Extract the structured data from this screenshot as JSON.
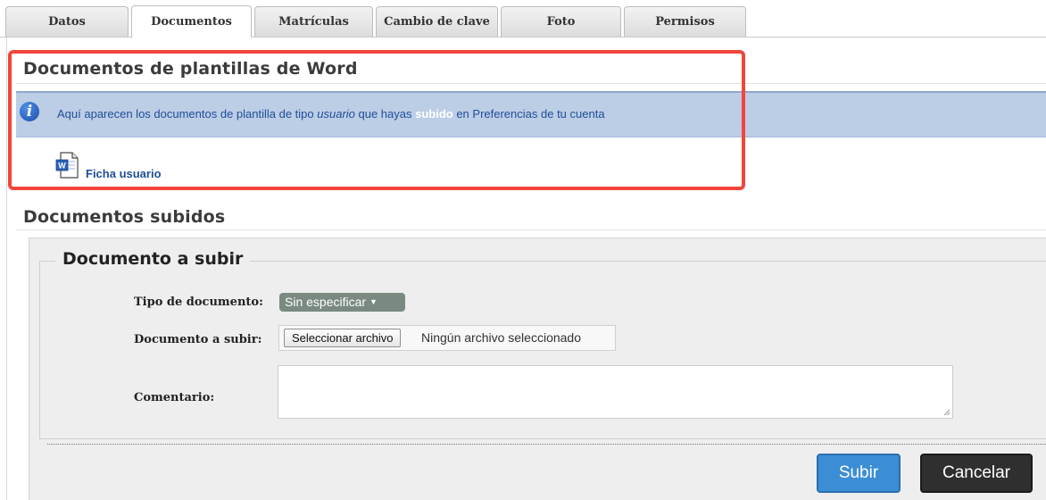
{
  "tabs": [
    {
      "label": "Datos",
      "active": false
    },
    {
      "label": "Documentos",
      "active": true
    },
    {
      "label": "Matrículas",
      "active": false
    },
    {
      "label": "Cambio de clave",
      "active": false
    },
    {
      "label": "Foto",
      "active": false
    },
    {
      "label": "Permisos",
      "active": false
    }
  ],
  "word_templates": {
    "title": "Documentos de plantillas de Word",
    "info": {
      "icon": "info-icon",
      "part1": "Aquí aparecen los documentos de plantilla de tipo ",
      "emphasis": "usuario",
      "part2": " que hayas ",
      "highlight": "subido",
      "part3": " en Preferencias de tu cuenta"
    },
    "documents": [
      {
        "icon": "word-document-icon",
        "name": "Ficha usuario"
      }
    ]
  },
  "uploaded": {
    "title": "Documentos subidos"
  },
  "upload_form": {
    "legend": "Documento a subir",
    "type_label": "Tipo de documento:",
    "type_value": "Sin especificar",
    "file_label": "Documento a subir:",
    "file_button": "Seleccionar archivo",
    "file_status": "Ningún archivo seleccionado",
    "comment_label": "Comentario:",
    "comment_value": "",
    "submit_label": "Subir",
    "cancel_label": "Cancelar"
  },
  "colors": {
    "info_bar": "#bccde6",
    "link": "#1f4e96",
    "highlight_frame": "#f2453b",
    "submit": "#3b8ed6",
    "cancel": "#2f2f2f"
  }
}
